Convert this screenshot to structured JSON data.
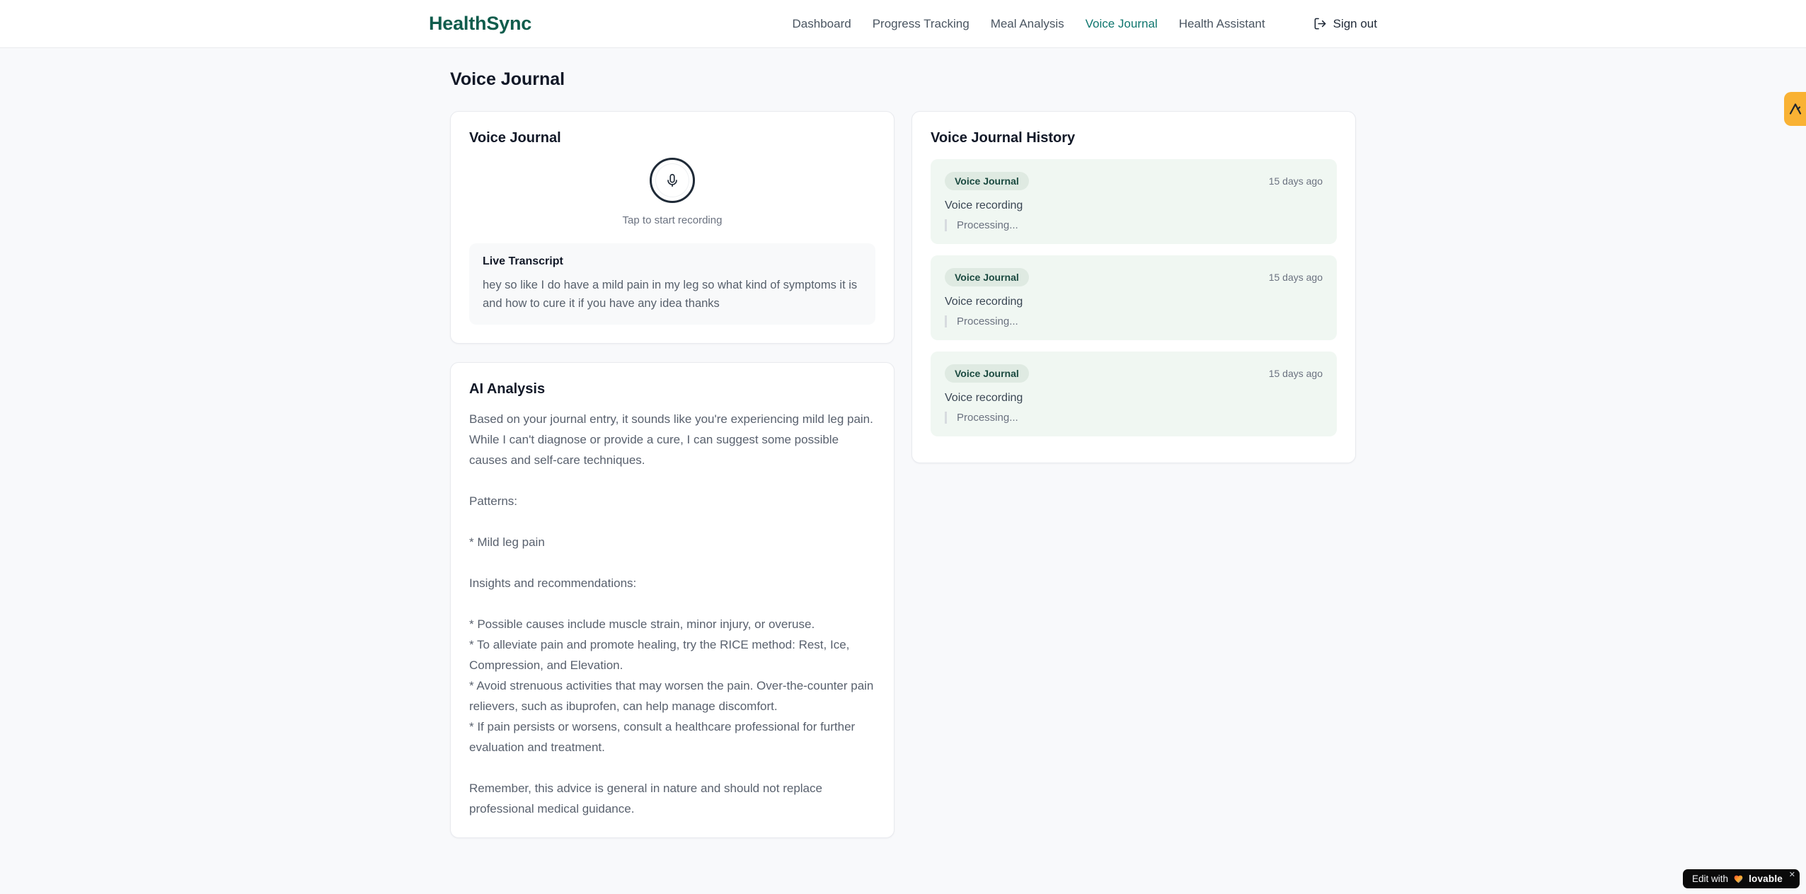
{
  "header": {
    "logo": "HealthSync",
    "nav": [
      {
        "label": "Dashboard",
        "active": false
      },
      {
        "label": "Progress Tracking",
        "active": false
      },
      {
        "label": "Meal Analysis",
        "active": false
      },
      {
        "label": "Voice Journal",
        "active": true
      },
      {
        "label": "Health Assistant",
        "active": false
      }
    ],
    "sign_out_label": "Sign out"
  },
  "page": {
    "title": "Voice Journal"
  },
  "recorder_card": {
    "title": "Voice Journal",
    "tap_hint": "Tap to start recording",
    "transcript_title": "Live Transcript",
    "transcript_text": "hey so like I do have a mild pain in my leg so what kind of symptoms it is and how to cure it if you have any idea thanks"
  },
  "analysis_card": {
    "title": "AI Analysis",
    "body": "Based on your journal entry, it sounds like you're experiencing mild leg pain. While I can't diagnose or provide a cure, I can suggest some possible causes and self-care techniques.\n\nPatterns:\n\n* Mild leg pain\n\nInsights and recommendations:\n\n* Possible causes include muscle strain, minor injury, or overuse.\n* To alleviate pain and promote healing, try the RICE method: Rest, Ice, Compression, and Elevation.\n* Avoid strenuous activities that may worsen the pain. Over-the-counter pain relievers, such as ibuprofen, can help manage discomfort.\n* If pain persists or worsens, consult a healthcare professional for further evaluation and treatment.\n\nRemember, this advice is general in nature and should not replace professional medical guidance."
  },
  "history_card": {
    "title": "Voice Journal History",
    "entries": [
      {
        "badge": "Voice Journal",
        "time": "15 days ago",
        "label": "Voice recording",
        "status": "Processing..."
      },
      {
        "badge": "Voice Journal",
        "time": "15 days ago",
        "label": "Voice recording",
        "status": "Processing..."
      },
      {
        "badge": "Voice Journal",
        "time": "15 days ago",
        "label": "Voice recording",
        "status": "Processing..."
      }
    ]
  },
  "widgets": {
    "lovable_prefix": "Edit with",
    "lovable_brand": "lovable",
    "lovable_close": "✕"
  },
  "icons": {
    "mic": "mic-icon",
    "sign_out": "sign-out-icon",
    "heart": "heart-icon",
    "close": "close-icon",
    "amber_logo": "lambda-logo-icon"
  },
  "colors": {
    "brand": "#0f5c4c",
    "accent": "#0f766e",
    "page_bg": "#f8f9fb",
    "history_bg": "#f0f7f2",
    "badge_bg": "#dfeae2",
    "badge_text": "#1b4a40",
    "widget_amber": "#f9b234",
    "lovable_bg": "#0a0a0a"
  }
}
